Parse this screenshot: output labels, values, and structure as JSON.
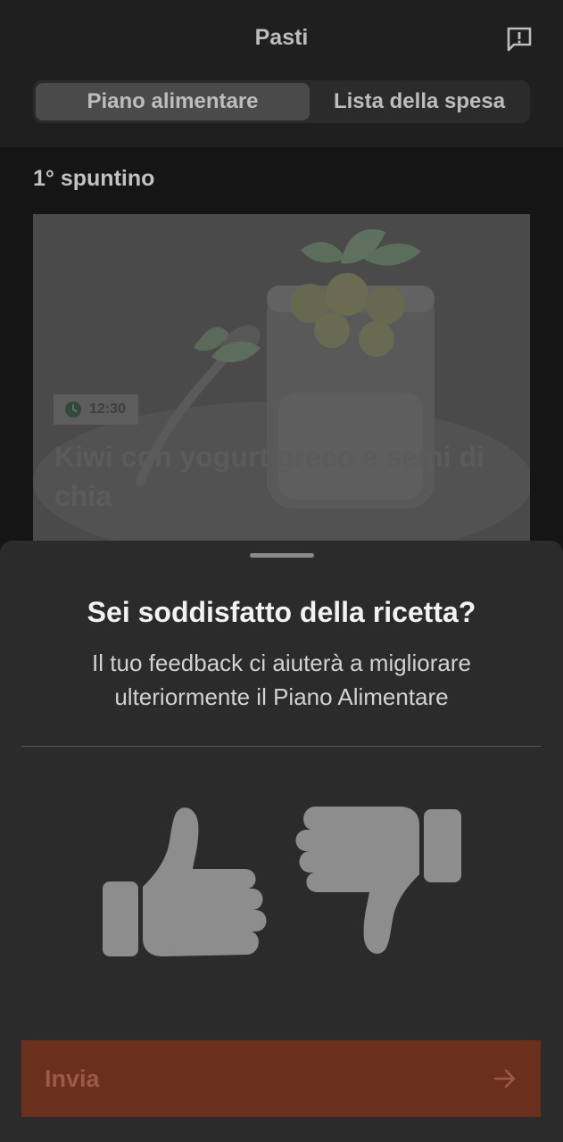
{
  "header": {
    "title": "Pasti",
    "report_icon": "feedback-report-icon",
    "tabs": [
      {
        "label": "Piano alimentare",
        "active": true
      },
      {
        "label": "Lista della spesa",
        "active": false
      }
    ]
  },
  "meal": {
    "section_title": "1° spuntino",
    "card": {
      "time": "12:30",
      "title": "Kiwi con yogurt greco e semi di chia",
      "time_icon": "clock-icon"
    }
  },
  "feedback_sheet": {
    "title": "Sei soddisfatto della ricetta?",
    "subtitle": "Il tuo feedback ci aiuterà a migliorare ulteriormente il Piano Alimentare",
    "like_icon": "thumbs-up-icon",
    "dislike_icon": "thumbs-down-icon",
    "submit_label": "Invia",
    "submit_icon": "arrow-right-icon"
  },
  "colors": {
    "background": "#151515",
    "sheet": "#2b2b2b",
    "accent": "#6b2f1d"
  }
}
